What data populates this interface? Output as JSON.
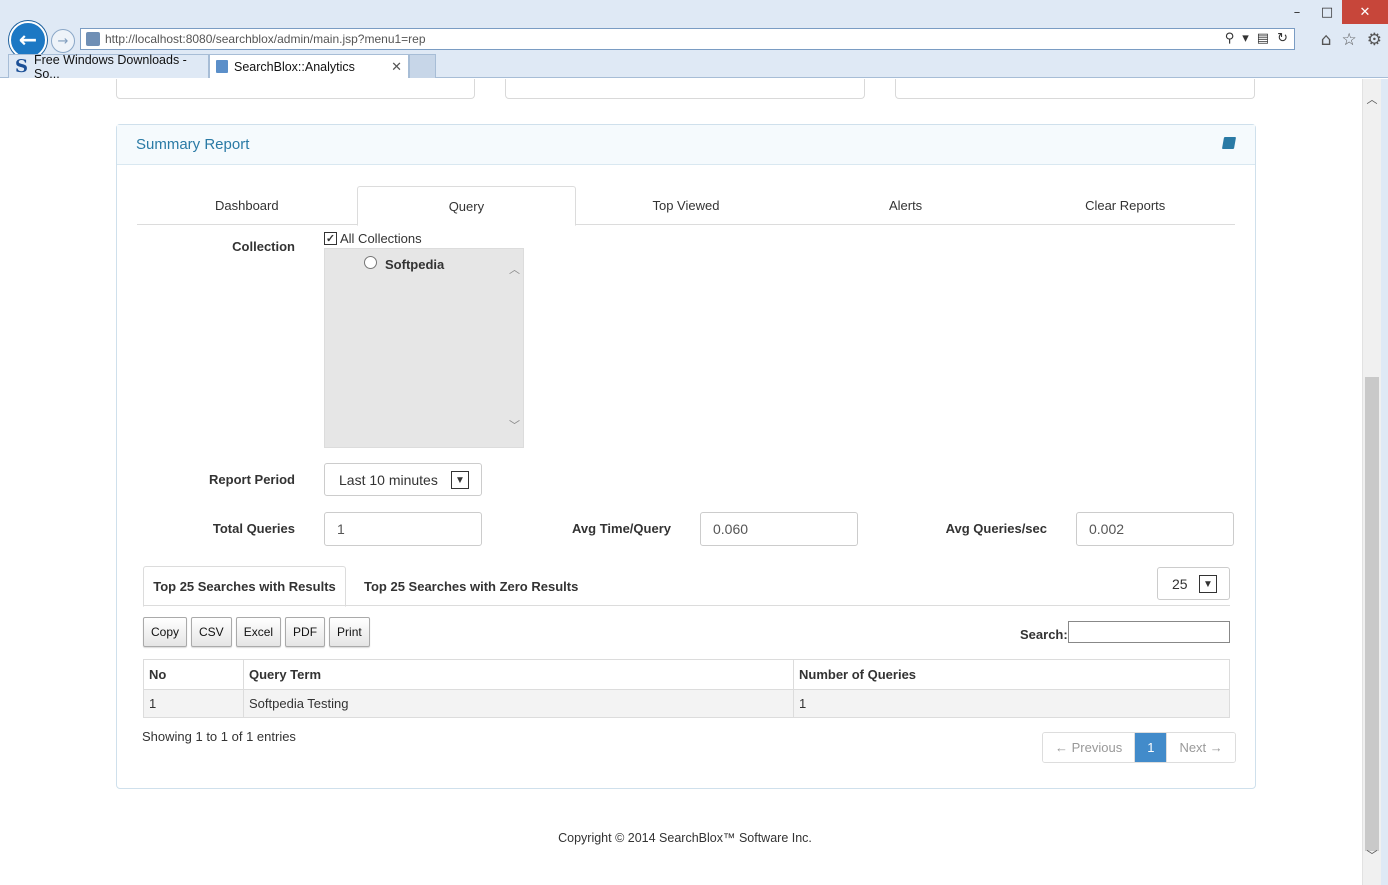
{
  "browser": {
    "url": "http://localhost:8080/searchblox/admin/main.jsp?menu1=rep",
    "tabs": [
      {
        "label": "Free Windows Downloads - So..."
      },
      {
        "label": "SearchBlox::Analytics"
      }
    ]
  },
  "panel": {
    "title": "Summary Report",
    "tabs": [
      "Dashboard",
      "Query",
      "Top Viewed",
      "Alerts",
      "Clear Reports"
    ],
    "active_tab": "Query"
  },
  "form": {
    "collection_label": "Collection",
    "all_collections_label": "All Collections",
    "all_collections_checked": true,
    "collections": [
      "Softpedia"
    ],
    "report_period_label": "Report Period",
    "report_period_value": "Last 10 minutes",
    "total_queries_label": "Total Queries",
    "total_queries_value": "1",
    "avg_time_label": "Avg Time/Query",
    "avg_time_value": "0.060",
    "avg_qps_label": "Avg Queries/sec",
    "avg_qps_value": "0.002"
  },
  "results": {
    "tab_with_results": "Top 25 Searches with Results",
    "tab_zero_results": "Top 25 Searches with Zero Results",
    "page_size": "25",
    "buttons": [
      "Copy",
      "CSV",
      "Excel",
      "PDF",
      "Print"
    ],
    "search_label": "Search:",
    "columns": [
      "No",
      "Query Term",
      "Number of Queries"
    ],
    "rows": [
      [
        "1",
        "Softpedia Testing",
        "1"
      ]
    ],
    "info": "Showing 1 to 1 of 1 entries",
    "prev_label": "← Previous",
    "current_page": "1",
    "next_label": "Next →"
  },
  "footer": "Copyright © 2014 SearchBlox™ Software Inc."
}
